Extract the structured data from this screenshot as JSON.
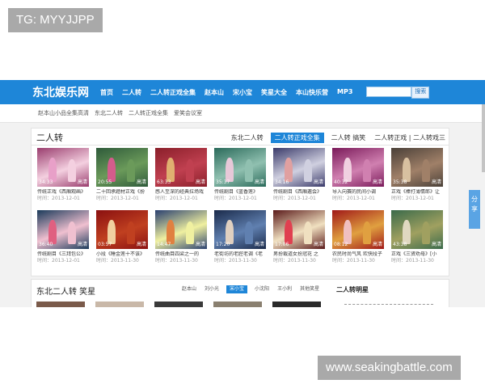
{
  "watermark_top": "TG: MYYJJPP",
  "watermark_bottom": "www.seakingbattle.com",
  "site": {
    "logo": "东北娱乐网",
    "nav": [
      "首页",
      "二人转",
      "二人转正戏全集",
      "赵本山",
      "宋小宝",
      "笑星大全",
      "本山快乐营",
      "MP3"
    ],
    "search_button": "搜索"
  },
  "subnav": [
    "赵本山小品全集高清",
    "东北二人转",
    "二人转正戏全集",
    "爱笑会议室"
  ],
  "section1": {
    "title": "二人转",
    "tabs": [
      "东北二人转",
      "二人转正戏全集",
      "二人转 搞笑",
      "二人转正戏 | 二人转戏三"
    ],
    "active_tab": 1,
    "videos": [
      {
        "duration": "34:33",
        "hd": "高清",
        "title": "传统正戏《西厢观画》",
        "time": "时间：2013-12-01"
      },
      {
        "duration": "20:55",
        "hd": "高清",
        "title": "二十回承题材正戏《扮",
        "time": "时间：2013-12-01"
      },
      {
        "duration": "63:33",
        "hd": "高清",
        "title": "感人至深的经典拉场戏",
        "time": "时间：2013-12-01"
      },
      {
        "duration": "35:37",
        "hd": "高清",
        "title": "传统剧目《蓝香莲》",
        "time": "时间：2013-12-01"
      },
      {
        "duration": "34:16",
        "hd": "高清",
        "title": "传统剧目《西厢邀会》",
        "time": "时间：2013-12-01"
      },
      {
        "duration": "40:32",
        "hd": "高清",
        "title": "导入向赛的民间小调",
        "time": "时间：2013-12-01"
      },
      {
        "duration": "35:38",
        "hd": "高清",
        "title": "正戏《棒打薄情郎》让",
        "time": "时间：2013-12-01"
      },
      {
        "duration": "36:40",
        "hd": "高清",
        "title": "传统剧目《三拜包公》",
        "time": "时间：2013-12-01"
      },
      {
        "duration": "03:57",
        "hd": "高清",
        "title": "小段《睡金莲十不该》",
        "time": "时间：2013-11-30"
      },
      {
        "duration": "14:47",
        "hd": "高清",
        "title": "传统曲目四梁之一的",
        "time": "时间：2013-11-30"
      },
      {
        "duration": "17:20",
        "hd": "高清",
        "title": "老街坊的老腔老调《老",
        "time": "时间：2013-11-30"
      },
      {
        "duration": "17:06",
        "hd": "高清",
        "title": "男扮裁道女扮冠花 之",
        "time": "时间：2013-11-30"
      },
      {
        "duration": "08:12",
        "hd": "高清",
        "title": "农民时尚气风 欢快段子",
        "time": "时间：2013-11-30"
      },
      {
        "duration": "43:38",
        "hd": "高清",
        "title": "正戏《三贤劝母》[小",
        "time": "时间：2013-11-30"
      }
    ]
  },
  "section2": {
    "title": "东北二人转 笑星",
    "tabs": [
      "赵本山",
      "刘小光",
      "宋小宝",
      "小沈阳",
      "王小利",
      "其他笑星"
    ],
    "active_tab": 2,
    "side_title": "二人转明星"
  },
  "share_label": "分享",
  "colors": {
    "brand": "#1e86d8",
    "share": "#5aa4e4",
    "watermark": "#a9a9a9"
  }
}
